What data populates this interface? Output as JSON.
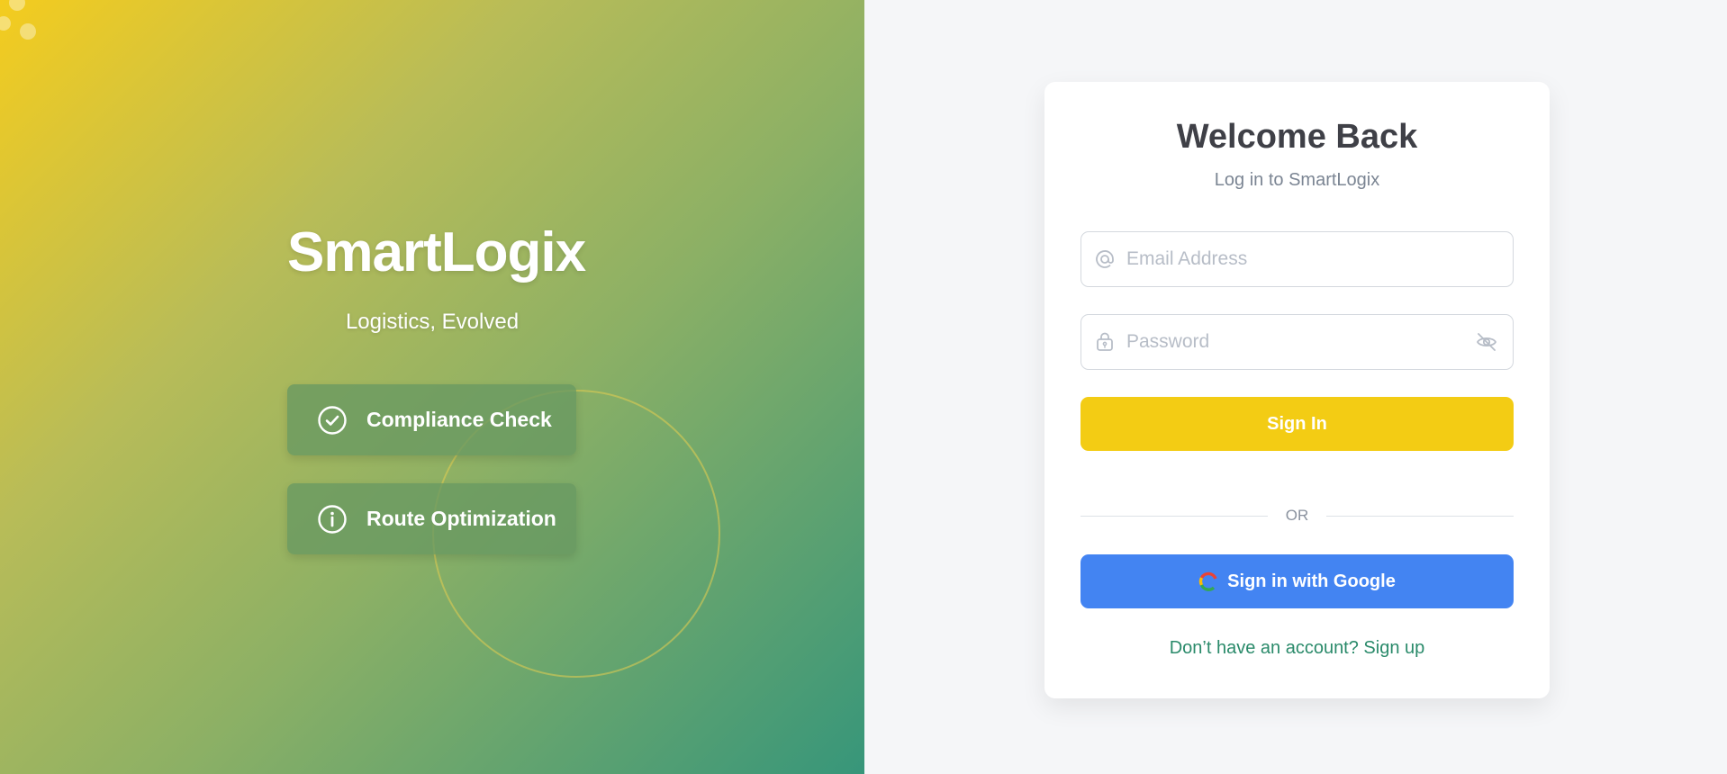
{
  "hero": {
    "brand": "SmartLogix",
    "tagline": "Logistics, Evolved",
    "features": [
      {
        "label": "Compliance Check",
        "icon": "check-circle-icon"
      },
      {
        "label": "Route Optimization",
        "icon": "info-circle-icon"
      }
    ]
  },
  "login": {
    "title": "Welcome Back",
    "subtitle": "Log in to SmartLogix",
    "email": {
      "value": "",
      "placeholder": "Email Address",
      "icon": "at-sign-icon"
    },
    "password": {
      "value": "",
      "placeholder": "Password",
      "icon": "lock-icon",
      "toggle_icon": "eye-off-icon"
    },
    "signin_label": "Sign In",
    "divider_label": "OR",
    "google_label": "Sign in with Google",
    "signup_text": "Don’t have an account? Sign up"
  },
  "colors": {
    "accent_yellow": "#f3cc14",
    "google_blue": "#4384f2",
    "link_green": "#2a8a6a",
    "gradient_start": "#f4cc1e",
    "gradient_end": "#37967a"
  }
}
